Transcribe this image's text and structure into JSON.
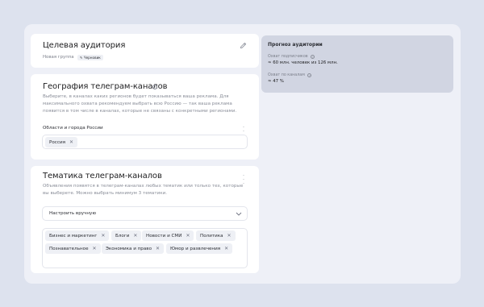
{
  "audience": {
    "title": "Целевая аудитория",
    "group_label": "Новая группа",
    "draft_badge": "Черновик"
  },
  "geography": {
    "title": "География телеграм-каналов",
    "description_line1": "Выберите, в каналах каких регионов будет показываться ваша реклама. Для",
    "description_line2": "максимального охвата рекомендуем выбрать всю Россию — так ваша реклама",
    "description_line3": "появится в том числе в каналах, которые не связаны с конкретными регионами.",
    "field_label": "Области и города России",
    "tags": [
      "Россия"
    ]
  },
  "topics": {
    "title": "Тематика телеграм-каналов",
    "description_line1": "Объявления появятся в телеграм-каналах любых тематик или только тех, которые",
    "description_line2": "вы выберете. Можно выбрать минимум 3 тематики.",
    "select_value": "Настроить вручную",
    "tags": [
      "Бизнес и маркетинг",
      "Блоги",
      "Новости и СМИ",
      "Политика",
      "Познавательное",
      "Экономика и право",
      "Юмор и развлечения"
    ]
  },
  "forecast": {
    "title": "Прогноз аудитории",
    "subscribers_label": "Охват подписчиков",
    "subscribers_value": "≈ 60 млн. человек из 126 млн.",
    "channels_label": "Охват по каналам",
    "channels_value": "≈ 47 %"
  },
  "icons": {
    "edit": "pencil-icon",
    "info": "info-icon",
    "more": "vertical-dots-icon",
    "remove": "close-icon",
    "expand": "chevron-down-icon"
  }
}
